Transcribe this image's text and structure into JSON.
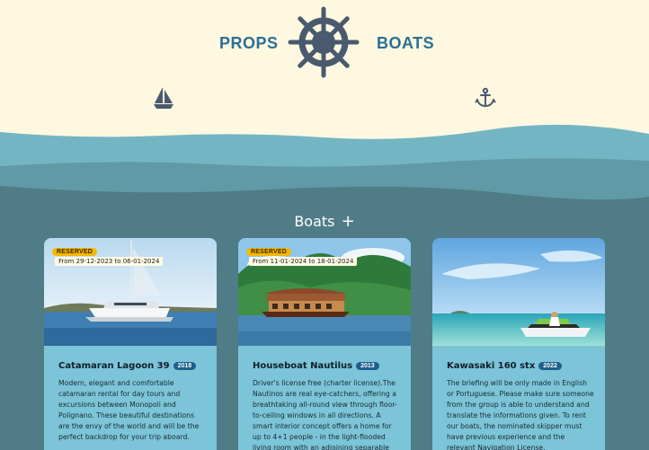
{
  "header": {
    "brand_left": "PROPS",
    "brand_right": "BOATS",
    "logo_icon": "ship-wheel-icon",
    "left_icon": "sailboat-icon",
    "right_icon": "anchor-icon"
  },
  "section": {
    "title": "Boats",
    "add_symbol": "+"
  },
  "boats": [
    {
      "name": "Catamaran Lagoon 39",
      "year": "2018",
      "reserved_label": "RESERVED",
      "reserved_dates": "From 29-12-2023 to 06-01-2024",
      "description": "Modern, elegant and comfortable catamaran rental for day tours and excursions between Monopoli and Polignano. These beautiful destinations are the envy of the world and will be the perfect backdrop for your trip aboard."
    },
    {
      "name": "Houseboat Nautilus",
      "year": "2013",
      "reserved_label": "RESERVED",
      "reserved_dates": "From 11-01-2024 to 18-01-2024",
      "description": "Driver's license free (charter license).The Nautinos are real eye-catchers, offering a breathtaking all-round view through floor-to-ceiling windows in all directions. A smart interior concept offers a home for up to 4+1 people - in the light-flooded living room with an adjoining separable sleeping area"
    },
    {
      "name": "Kawasaki 160 stx",
      "year": "2022",
      "description": "The briefing will be only made in English or Portuguese. Please make sure someone from the group is able to understand and translate the informations given. To rent our boats, the nominated skipper must have previous experience and the relevant Navigation License."
    }
  ],
  "colors": {
    "header_bg": "#fef8e0",
    "brand": "#2a6f97",
    "icon": "#4a5a6e",
    "page_bg": "#4f7c86",
    "card_bg": "#7cc4d8",
    "reserved_badge": "#f5b800",
    "year_badge": "#1f5f8b"
  }
}
